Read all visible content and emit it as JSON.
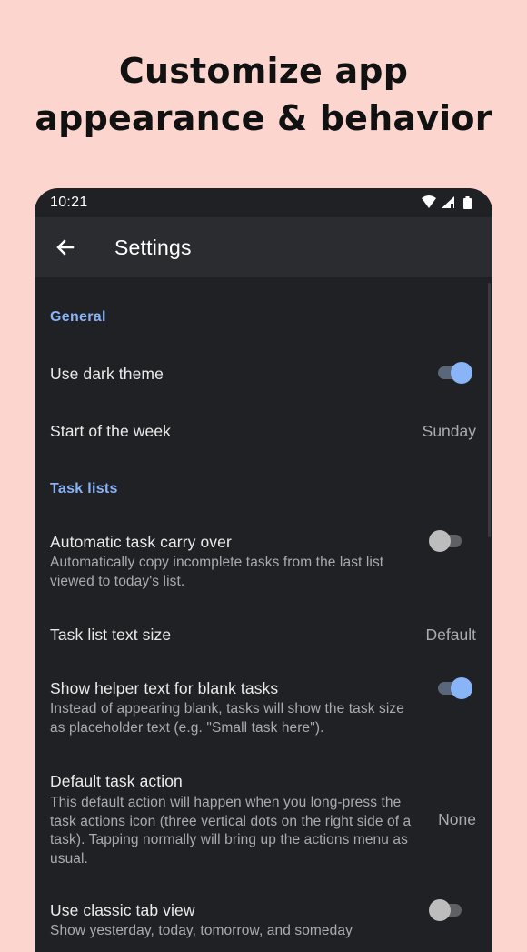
{
  "headline": {
    "line1": "Customize app",
    "line2": "appearance & behavior"
  },
  "status_bar": {
    "time": "10:21",
    "icons": [
      "wifi-icon",
      "cell-signal-icon",
      "battery-icon"
    ]
  },
  "app_bar": {
    "back_icon": "arrow-back-icon",
    "title": "Settings"
  },
  "sections": {
    "general": "General",
    "task_lists": "Task lists"
  },
  "settings": {
    "dark_theme": {
      "title": "Use dark theme",
      "enabled": true
    },
    "week_start": {
      "title": "Start of the week",
      "value": "Sunday"
    },
    "carry_over": {
      "title": "Automatic task carry over",
      "subtitle": "Automatically copy incomplete tasks from the last list viewed to today's list.",
      "enabled": false
    },
    "text_size": {
      "title": "Task list text size",
      "value": "Default"
    },
    "helper_text": {
      "title": "Show helper text for blank tasks",
      "subtitle": "Instead of appearing blank, tasks will show the task size as placeholder text (e.g. \"Small task here\").",
      "enabled": true
    },
    "default_action": {
      "title": "Default task action",
      "subtitle": "This default action will happen when you long-press the task actions icon (three vertical dots on the right side of a task). Tapping normally will bring up the actions menu as usual.",
      "value": "None"
    },
    "classic_tab": {
      "title": "Use classic tab view",
      "subtitle": "Show yesterday, today, tomorrow, and someday",
      "enabled": false
    }
  },
  "colors": {
    "background": "#fcd5cf",
    "phone_surface": "#202124",
    "app_bar": "#2b2c2f",
    "accent": "#8ab4f8"
  }
}
